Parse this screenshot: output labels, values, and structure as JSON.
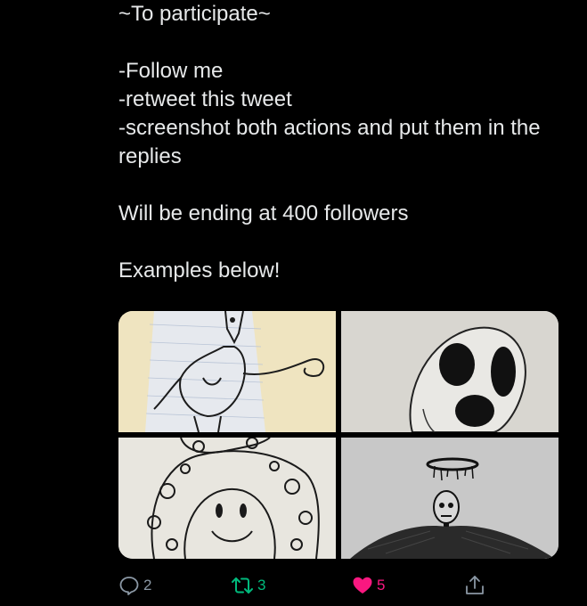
{
  "tweet": {
    "lines": [
      "~To participate~",
      "",
      "-Follow me",
      "-retweet this tweet",
      "-screenshot both actions and put them in the replies",
      "",
      "Will be ending at 400 followers",
      "",
      "Examples below!"
    ]
  },
  "media": {
    "images": [
      {
        "icon": "sketch-tall-figure-image"
      },
      {
        "icon": "sketch-mask-image"
      },
      {
        "icon": "sketch-smiling-mushroom-image"
      },
      {
        "icon": "sketch-winged-figure-image"
      }
    ]
  },
  "actions": {
    "reply_count": "2",
    "retweet_count": "3",
    "like_count": "5",
    "colors": {
      "reply": "#8b98a5",
      "retweet": "#00ba7c",
      "like": "#f91880"
    }
  }
}
